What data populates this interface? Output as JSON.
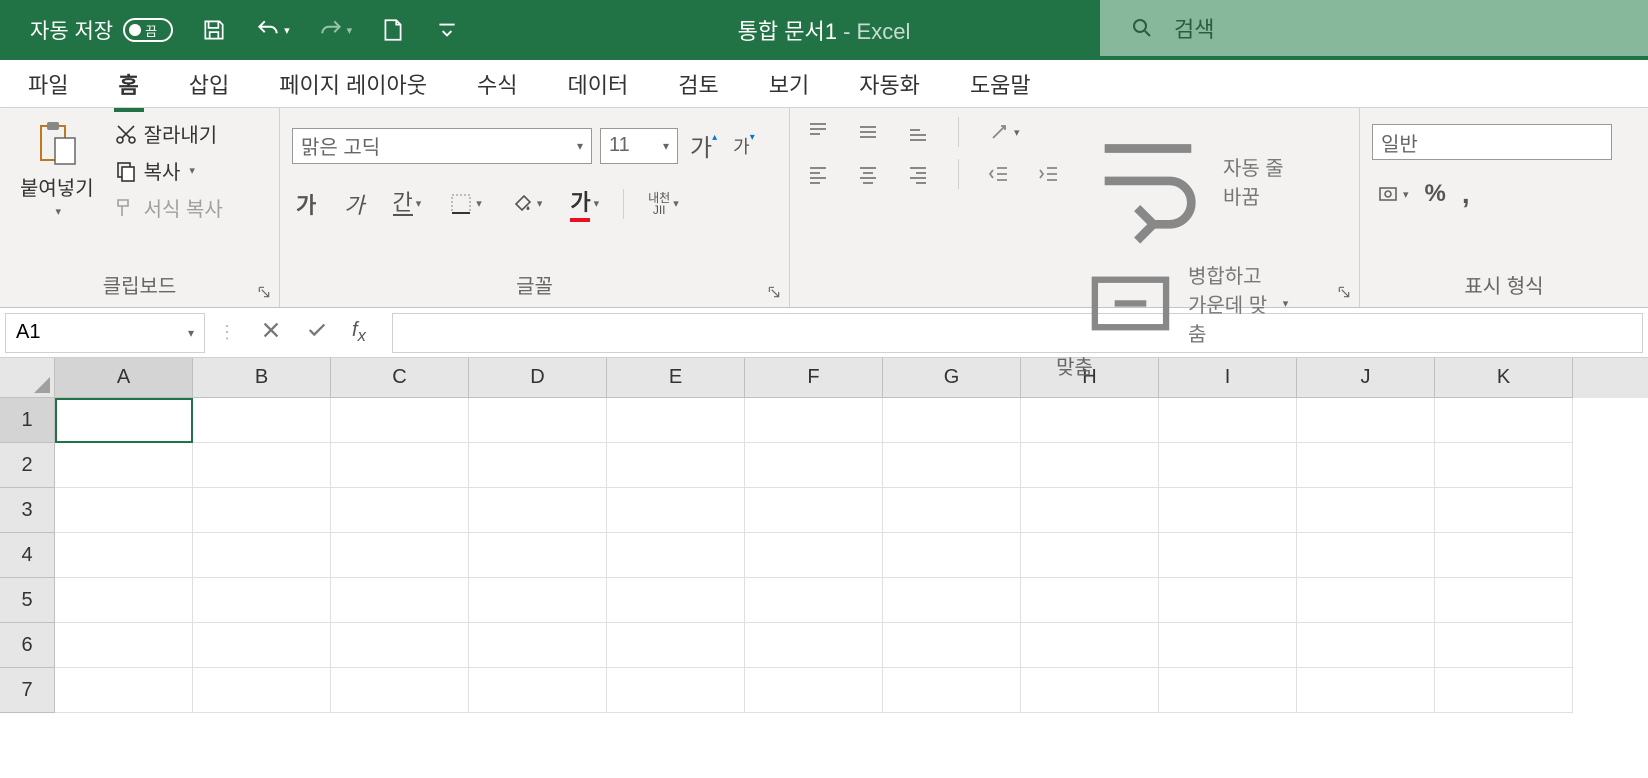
{
  "titlebar": {
    "autosave_label": "자동 저장",
    "autosave_state": "끔",
    "doc_name": "통합 문서1",
    "separator": "  -  ",
    "app_name": "Excel",
    "search_placeholder": "검색"
  },
  "tabs": {
    "file": "파일",
    "home": "홈",
    "insert": "삽입",
    "pagelayout": "페이지 레이아웃",
    "formulas": "수식",
    "data": "데이터",
    "review": "검토",
    "view": "보기",
    "automate": "자동화",
    "help": "도움말"
  },
  "ribbon": {
    "clipboard": {
      "paste": "붙여넣기",
      "cut": "잘라내기",
      "copy": "복사",
      "format_painter": "서식 복사",
      "group_label": "클립보드"
    },
    "font": {
      "font_name": "맑은 고딕",
      "font_size": "11",
      "increase_char": "가",
      "decrease_char": "가",
      "bold": "가",
      "italic": "가",
      "underline": "간",
      "ruby": "내천",
      "ruby2": "JII",
      "color_char": "가",
      "group_label": "글꼴"
    },
    "alignment": {
      "wrap_text": "자동 줄 바꿈",
      "merge_center": "병합하고 가운데 맞춤",
      "group_label": "맞춤"
    },
    "number": {
      "format": "일반",
      "group_label": "표시 형식"
    }
  },
  "formula_bar": {
    "name_box": "A1"
  },
  "grid": {
    "columns": [
      "A",
      "B",
      "C",
      "D",
      "E",
      "F",
      "G",
      "H",
      "I",
      "J",
      "K"
    ],
    "rows": [
      "1",
      "2",
      "3",
      "4",
      "5",
      "6",
      "7"
    ],
    "active_cell": "A1"
  }
}
